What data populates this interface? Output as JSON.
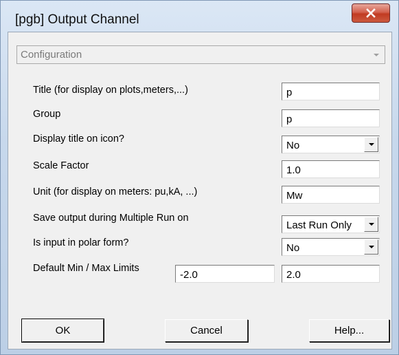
{
  "window": {
    "title": "[pgb] Output Channel"
  },
  "section_selector": {
    "value": "Configuration"
  },
  "fields": [
    {
      "label": "Title (for display on plots,meters,...)",
      "value": "p",
      "type": "text"
    },
    {
      "label": "Group",
      "value": "p",
      "type": "text"
    },
    {
      "label": "Display title on icon?",
      "value": "No",
      "type": "dropdown"
    },
    {
      "label": "Scale Factor",
      "value": "1.0",
      "type": "text"
    },
    {
      "label": "Unit  (for display on meters: pu,kA, ...)",
      "value": "Mw",
      "type": "text"
    },
    {
      "label": "Save output during Multiple Run on",
      "value": "Last Run Only",
      "type": "dropdown"
    },
    {
      "label": "Is input in polar form?",
      "value": "No",
      "type": "dropdown"
    },
    {
      "label": "Default Min / Max  Limits",
      "min": "-2.0",
      "max": "2.0",
      "type": "range"
    }
  ],
  "buttons": {
    "ok": "OK",
    "cancel": "Cancel",
    "help": "Help..."
  },
  "icons": {
    "close": "close-icon",
    "dropdown": "chevron-down-icon"
  },
  "colors": {
    "close_button": "#c13b22",
    "dialog_background": "#f0f0f0",
    "disabled_text": "#7a7a7a"
  }
}
